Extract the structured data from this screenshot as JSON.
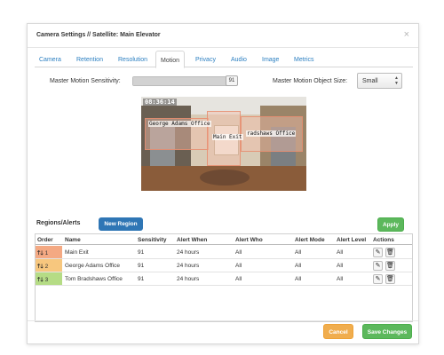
{
  "dialog": {
    "title": "Camera Settings // Satellite: Main Elevator",
    "close_glyph": "×"
  },
  "tabs": [
    {
      "label": "Camera",
      "active": false
    },
    {
      "label": "Retention",
      "active": false
    },
    {
      "label": "Resolution",
      "active": false
    },
    {
      "label": "Motion",
      "active": true
    },
    {
      "label": "Privacy",
      "active": false
    },
    {
      "label": "Audio",
      "active": false
    },
    {
      "label": "Image",
      "active": false
    },
    {
      "label": "Metrics",
      "active": false
    }
  ],
  "motion": {
    "sensitivity_label": "Master Motion Sensitivity:",
    "sensitivity_value": "91",
    "sensitivity_fraction": 0.91,
    "object_size_label": "Master Motion Object Size:",
    "object_size_value": "Small"
  },
  "camera_preview": {
    "timestamp": "08:36:14",
    "regions": [
      "George Adams Office",
      "Main Exit",
      "Tom Bradshaws Office"
    ],
    "region_labels_visible": [
      "George Adams Office",
      "Main Exit",
      "radshaws Office"
    ]
  },
  "regions_section": {
    "title": "Regions/Alerts",
    "new_region_label": "New Region",
    "apply_label": "Apply"
  },
  "table": {
    "headers": [
      "Order",
      "Name",
      "Sensitivity",
      "Alert When",
      "Alert Who",
      "Alert Mode",
      "Alert Level",
      "Actions"
    ],
    "rows": [
      {
        "order": "1",
        "name": "Main Exit",
        "sensitivity": "91",
        "alert_when": "24 hours",
        "alert_who": "All",
        "alert_mode": "All",
        "alert_level": "All",
        "color": "#f4a983"
      },
      {
        "order": "2",
        "name": "George Adams Office",
        "sensitivity": "91",
        "alert_when": "24 hours",
        "alert_who": "All",
        "alert_mode": "All",
        "alert_level": "All",
        "color": "#f7c77e"
      },
      {
        "order": "3",
        "name": "Tom Bradshaws Office",
        "sensitivity": "91",
        "alert_when": "24 hours",
        "alert_who": "All",
        "alert_mode": "All",
        "alert_level": "All",
        "color": "#b5dc85"
      }
    ],
    "arrow_up": "🡑",
    "arrow_down": "🡓",
    "edit_icon": "✎",
    "delete_icon": "🗑"
  },
  "footer": {
    "cancel_label": "Cancel",
    "save_label": "Save Changes"
  },
  "colors": {
    "link_blue": "#2b7fc1",
    "primary": "#2f76b5",
    "success": "#5cb85c",
    "warning": "#f0ad4e"
  }
}
